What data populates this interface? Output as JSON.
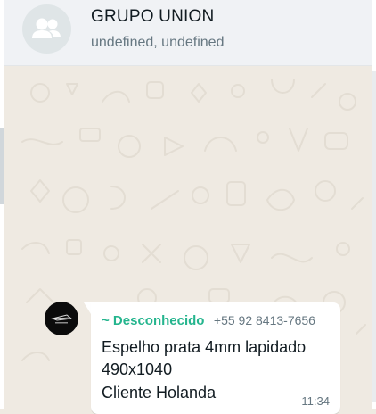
{
  "header": {
    "group_name": "GRUPO UNION",
    "subtitle": "undefined, undefined",
    "avatar_icon": "group-avatar-icon"
  },
  "messages": [
    {
      "sender_name": "~ Desconhecido",
      "sender_phone": "+55 92 8413-7656",
      "lines": [
        "Espelho prata 4mm lapidado",
        "490x1040",
        "Cliente Holanda"
      ],
      "time": "11:34",
      "avatar": "sender-logo-avatar"
    }
  ],
  "colors": {
    "header_bg": "#f0f2f5",
    "chat_bg": "#efeae2",
    "sender_name": "#25b58e",
    "bubble_bg": "#ffffff"
  }
}
